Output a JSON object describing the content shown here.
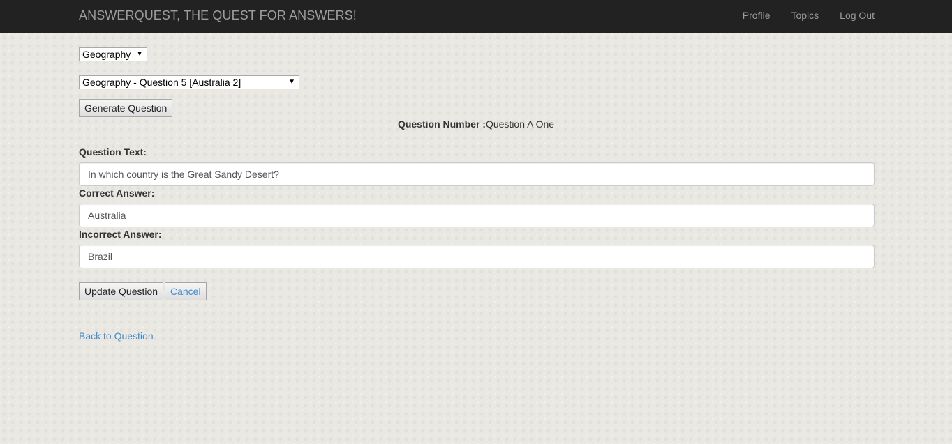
{
  "navbar": {
    "brand": "ANSWERQUEST, THE QUEST FOR ANSWERS!",
    "links": [
      {
        "label": "Profile"
      },
      {
        "label": "Topics"
      },
      {
        "label": "Log Out"
      }
    ]
  },
  "topic_select": {
    "selected": "Geography"
  },
  "question_select": {
    "selected": "Geography - Question 5 [Australia 2]"
  },
  "generate_button": {
    "label": "Generate Question"
  },
  "question_number": {
    "label": "Question Number :",
    "value": "Question A One"
  },
  "form": {
    "question_text": {
      "label": "Question Text:",
      "value": "In which country is the Great Sandy Desert?"
    },
    "correct_answer": {
      "label": "Correct Answer:",
      "value": "Australia"
    },
    "incorrect_answer": {
      "label": "Incorrect Answer:",
      "value": "Brazil"
    }
  },
  "actions": {
    "update_label": "Update Question",
    "cancel_label": "Cancel"
  },
  "back_link": {
    "label": "Back to Question"
  },
  "colors": {
    "navbar_bg": "#222222",
    "navbar_text": "#9d9d9d",
    "link": "#428bca",
    "page_bg": "#eae8e2"
  }
}
